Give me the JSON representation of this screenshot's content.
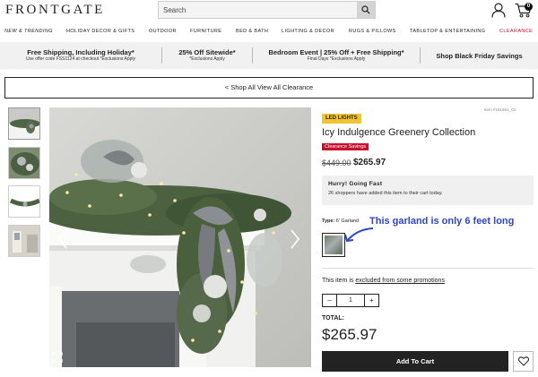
{
  "header": {
    "logo": "FRONTGATE",
    "search_placeholder": "Search",
    "cart_count": "0"
  },
  "nav": {
    "items": [
      {
        "label": "NEW & TRENDING"
      },
      {
        "label": "HOLIDAY DECOR & GIFTS"
      },
      {
        "label": "OUTDOOR"
      },
      {
        "label": "FURNITURE"
      },
      {
        "label": "BED & BATH"
      },
      {
        "label": "LIGHTING & DECOR"
      },
      {
        "label": "RUGS & PILLOWS"
      },
      {
        "label": "TABLETOP & ENTERTAINING"
      },
      {
        "label": "CLEARANCE"
      }
    ]
  },
  "promos": [
    {
      "title": "Free Shipping, Including Holiday*",
      "sub": "Use offer code FSS1124 at checkout *Exclusions Apply"
    },
    {
      "title": "25% Off Sitewide*",
      "sub": "*Exclusions Apply"
    },
    {
      "title": "Bedroom Event | 25% Off + Free Shipping*",
      "sub": "Final Days *Exclusions Apply"
    },
    {
      "title": "Shop Black Friday Savings",
      "sub": ""
    }
  ],
  "clearance_banner": "< Shop All View All Clearance",
  "product": {
    "item_no": "Item #181661_OL",
    "badge": "LED LIGHTS",
    "title": "Icy Indulgence Greenery Collection",
    "sale_tag": "Clearance Savings",
    "was_price": "$449.00",
    "price": "$265.97",
    "hurry_title": "Hurry! Going Fast",
    "hurry_text": "26 shoppers have added this item to their cart today.",
    "type_label": "Type:",
    "type_value": "6' Garland",
    "promo_note_prefix": "This item is ",
    "promo_note_link": "excluded from some promotions",
    "quantity": "1",
    "total_label": "TOTAL:",
    "total_value": "$265.97",
    "add_to_cart": "Add To Cart"
  },
  "annotation": "This garland is only 6 feet long",
  "colors": {
    "accent_red": "#c8102e",
    "badge_yellow": "#f0c531",
    "annotation_blue": "#2a46c9",
    "button_dark": "#232323"
  }
}
